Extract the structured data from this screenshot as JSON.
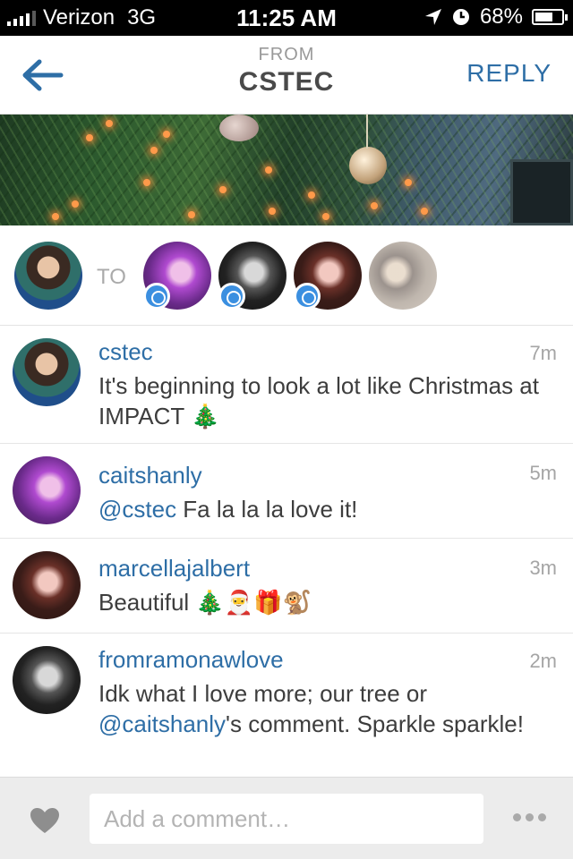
{
  "status_bar": {
    "carrier": "Verizon",
    "network": "3G",
    "time": "11:25 AM",
    "battery": "68%",
    "battery_level": 0.68,
    "icons": [
      "signal-bars-icon",
      "location-arrow-icon",
      "alarm-clock-icon",
      "battery-icon"
    ]
  },
  "header": {
    "subtitle": "FROM",
    "title": "CSTEC",
    "back_icon": "back-arrow-icon",
    "reply_label": "REPLY"
  },
  "recipients": {
    "to_label": "TO",
    "count": 4
  },
  "comments": [
    {
      "username": "cstec",
      "time": "7m",
      "text": "It's beginning to look a lot like Christmas at IMPACT",
      "emoji": "🎄"
    },
    {
      "username": "caitshanly",
      "time": "5m",
      "mention": "@cstec",
      "text": " Fa la la la love it!"
    },
    {
      "username": "marcellajalbert",
      "time": "3m",
      "text": "Beautiful",
      "emoji": "🎄🎅🎁🐒"
    },
    {
      "username": "fromramonawlove",
      "time": "2m",
      "text_before": "Idk what I love more; our tree or ",
      "mention": "@caitshanly",
      "text_after": "'s comment. Sparkle sparkle!"
    }
  ],
  "bottom_bar": {
    "like_icon": "heart-icon",
    "comment_placeholder": "Add a comment…",
    "more_icon": "more-dots-icon"
  },
  "colors": {
    "link_blue": "#2e6ea6",
    "dm_badge_blue": "#3b8fe0",
    "timestamp_gray": "#a5a5a5",
    "bottom_bar_bg": "#ececec"
  }
}
